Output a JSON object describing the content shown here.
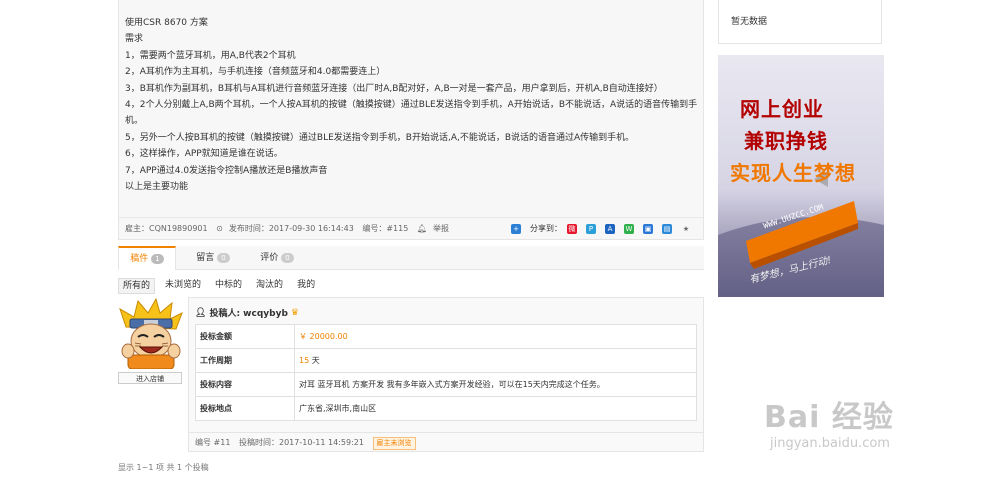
{
  "content": {
    "lines": [
      "使用CSR 8670 方案",
      "需求",
      "1，需要两个蓝牙耳机，用A,B代表2个耳机",
      "2，A耳机作为主耳机，与手机连接（音频蓝牙和4.0都需要连上）",
      "3，B耳机作为副耳机，B耳机与A耳机进行音频蓝牙连接（出厂时A,B配对好，A,B一对是一套产品，用户拿到后，开机A,B自动连接好）",
      "4，2个人分别戴上A,B两个耳机，一个人按A耳机的按键（触摸按键）通过BLE发送指令到手机，A开始说话，B不能说话，A说话的语音传输到手机。",
      "5，另外一个人按B耳机的按键（触摸按键）通过BLE发送指令到手机，B开始说话,A,不能说话，B说话的语音通过A传输到手机。",
      "6，这样操作，APP就知道是谁在说话。",
      "7，APP通过4.0发送指令控制A播放还是B播放声音",
      "以上是主要功能"
    ]
  },
  "meta": {
    "employer": "雇主：CQN19890901",
    "published": "发布时间：2017-09-30 16:14:43",
    "number": "编号：#115",
    "report": "举报",
    "share_label": "分享到："
  },
  "tabs": [
    {
      "label": "稿件",
      "count": "1"
    },
    {
      "label": "留言",
      "count": "0"
    },
    {
      "label": "评价",
      "count": "0"
    }
  ],
  "filters": [
    "所有的",
    "未浏览的",
    "中标的",
    "淘汰的",
    "我的"
  ],
  "bid": {
    "shop_button": "进入店铺",
    "bidder": "投稿人: wcqybyb",
    "rows": [
      {
        "label": "投标金额",
        "value": "￥ 20000.00"
      },
      {
        "label": "工作周期",
        "value_num": "15",
        "value_unit": " 天"
      },
      {
        "label": "投标内容",
        "value": "对耳 蓝牙耳机 方案开发 我有多年嵌入式方案开发经验，可以在15天内完成这个任务。"
      },
      {
        "label": "投标地点",
        "value": "广东省,深圳市,南山区"
      }
    ],
    "footer_number": "编号 #11",
    "footer_time": "投稿时间：2017-10-11 14:59:21",
    "status": "雇主未浏览"
  },
  "summary": "显示 1~1 项 共 1 个投稿",
  "sidebar": {
    "empty": "暂无数据",
    "ad_line1": "网上创业",
    "ad_line2": "兼职挣钱",
    "ad_line3": "实现人生梦想",
    "ad_url": "WWW.UUZCC.COM",
    "ad_slogan": "有梦想，马上行动!"
  },
  "watermark": {
    "text": "Bai 经验",
    "url": "jingyan.baidu.com"
  },
  "colors": {
    "accent": "#f08200",
    "border": "#e5e5e5",
    "panel": "#f7f7f7"
  }
}
